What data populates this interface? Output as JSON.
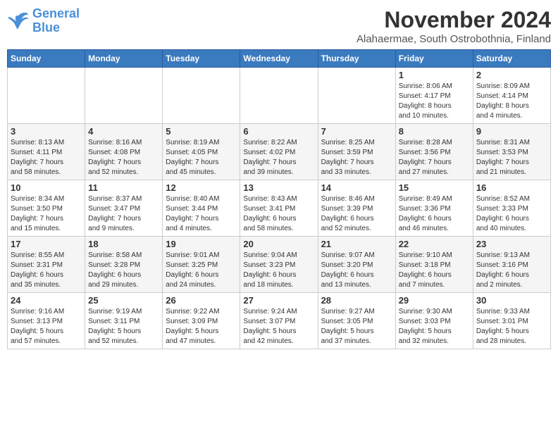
{
  "logo": {
    "text_general": "General",
    "text_blue": "Blue"
  },
  "header": {
    "month": "November 2024",
    "location": "Alahaermae, South Ostrobothnia, Finland"
  },
  "weekdays": [
    "Sunday",
    "Monday",
    "Tuesday",
    "Wednesday",
    "Thursday",
    "Friday",
    "Saturday"
  ],
  "weeks": [
    [
      {
        "day": "",
        "info": ""
      },
      {
        "day": "",
        "info": ""
      },
      {
        "day": "",
        "info": ""
      },
      {
        "day": "",
        "info": ""
      },
      {
        "day": "",
        "info": ""
      },
      {
        "day": "1",
        "info": "Sunrise: 8:06 AM\nSunset: 4:17 PM\nDaylight: 8 hours\nand 10 minutes."
      },
      {
        "day": "2",
        "info": "Sunrise: 8:09 AM\nSunset: 4:14 PM\nDaylight: 8 hours\nand 4 minutes."
      }
    ],
    [
      {
        "day": "3",
        "info": "Sunrise: 8:13 AM\nSunset: 4:11 PM\nDaylight: 7 hours\nand 58 minutes."
      },
      {
        "day": "4",
        "info": "Sunrise: 8:16 AM\nSunset: 4:08 PM\nDaylight: 7 hours\nand 52 minutes."
      },
      {
        "day": "5",
        "info": "Sunrise: 8:19 AM\nSunset: 4:05 PM\nDaylight: 7 hours\nand 45 minutes."
      },
      {
        "day": "6",
        "info": "Sunrise: 8:22 AM\nSunset: 4:02 PM\nDaylight: 7 hours\nand 39 minutes."
      },
      {
        "day": "7",
        "info": "Sunrise: 8:25 AM\nSunset: 3:59 PM\nDaylight: 7 hours\nand 33 minutes."
      },
      {
        "day": "8",
        "info": "Sunrise: 8:28 AM\nSunset: 3:56 PM\nDaylight: 7 hours\nand 27 minutes."
      },
      {
        "day": "9",
        "info": "Sunrise: 8:31 AM\nSunset: 3:53 PM\nDaylight: 7 hours\nand 21 minutes."
      }
    ],
    [
      {
        "day": "10",
        "info": "Sunrise: 8:34 AM\nSunset: 3:50 PM\nDaylight: 7 hours\nand 15 minutes."
      },
      {
        "day": "11",
        "info": "Sunrise: 8:37 AM\nSunset: 3:47 PM\nDaylight: 7 hours\nand 9 minutes."
      },
      {
        "day": "12",
        "info": "Sunrise: 8:40 AM\nSunset: 3:44 PM\nDaylight: 7 hours\nand 4 minutes."
      },
      {
        "day": "13",
        "info": "Sunrise: 8:43 AM\nSunset: 3:41 PM\nDaylight: 6 hours\nand 58 minutes."
      },
      {
        "day": "14",
        "info": "Sunrise: 8:46 AM\nSunset: 3:39 PM\nDaylight: 6 hours\nand 52 minutes."
      },
      {
        "day": "15",
        "info": "Sunrise: 8:49 AM\nSunset: 3:36 PM\nDaylight: 6 hours\nand 46 minutes."
      },
      {
        "day": "16",
        "info": "Sunrise: 8:52 AM\nSunset: 3:33 PM\nDaylight: 6 hours\nand 40 minutes."
      }
    ],
    [
      {
        "day": "17",
        "info": "Sunrise: 8:55 AM\nSunset: 3:31 PM\nDaylight: 6 hours\nand 35 minutes."
      },
      {
        "day": "18",
        "info": "Sunrise: 8:58 AM\nSunset: 3:28 PM\nDaylight: 6 hours\nand 29 minutes."
      },
      {
        "day": "19",
        "info": "Sunrise: 9:01 AM\nSunset: 3:25 PM\nDaylight: 6 hours\nand 24 minutes."
      },
      {
        "day": "20",
        "info": "Sunrise: 9:04 AM\nSunset: 3:23 PM\nDaylight: 6 hours\nand 18 minutes."
      },
      {
        "day": "21",
        "info": "Sunrise: 9:07 AM\nSunset: 3:20 PM\nDaylight: 6 hours\nand 13 minutes."
      },
      {
        "day": "22",
        "info": "Sunrise: 9:10 AM\nSunset: 3:18 PM\nDaylight: 6 hours\nand 7 minutes."
      },
      {
        "day": "23",
        "info": "Sunrise: 9:13 AM\nSunset: 3:16 PM\nDaylight: 6 hours\nand 2 minutes."
      }
    ],
    [
      {
        "day": "24",
        "info": "Sunrise: 9:16 AM\nSunset: 3:13 PM\nDaylight: 5 hours\nand 57 minutes."
      },
      {
        "day": "25",
        "info": "Sunrise: 9:19 AM\nSunset: 3:11 PM\nDaylight: 5 hours\nand 52 minutes."
      },
      {
        "day": "26",
        "info": "Sunrise: 9:22 AM\nSunset: 3:09 PM\nDaylight: 5 hours\nand 47 minutes."
      },
      {
        "day": "27",
        "info": "Sunrise: 9:24 AM\nSunset: 3:07 PM\nDaylight: 5 hours\nand 42 minutes."
      },
      {
        "day": "28",
        "info": "Sunrise: 9:27 AM\nSunset: 3:05 PM\nDaylight: 5 hours\nand 37 minutes."
      },
      {
        "day": "29",
        "info": "Sunrise: 9:30 AM\nSunset: 3:03 PM\nDaylight: 5 hours\nand 32 minutes."
      },
      {
        "day": "30",
        "info": "Sunrise: 9:33 AM\nSunset: 3:01 PM\nDaylight: 5 hours\nand 28 minutes."
      }
    ]
  ]
}
